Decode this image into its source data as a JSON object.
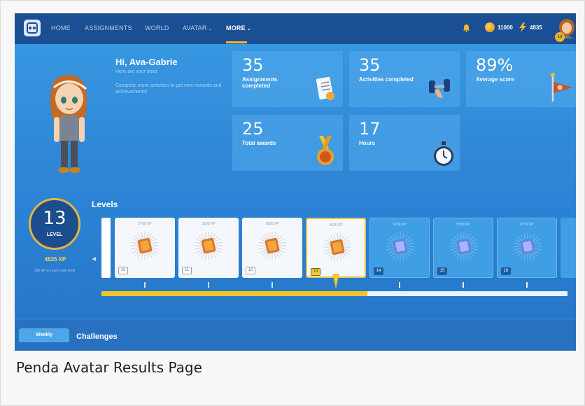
{
  "nav": {
    "items": [
      {
        "label": "HOME",
        "active": false
      },
      {
        "label": "ASSIGNMENTS",
        "active": false
      },
      {
        "label": "WORLD",
        "active": false
      },
      {
        "label": "AVATAR",
        "active": false,
        "caret": "⌄"
      },
      {
        "label": "MORE",
        "active": true,
        "caret": "⌄"
      }
    ],
    "coins": "11000",
    "xp": "4835",
    "avatar_level": "13"
  },
  "hero": {
    "greeting": "Hi, Ava-Gabrie",
    "subtitle": "Here are your stats",
    "description": "Complete more activities to get new rewards and achievements!"
  },
  "stats": [
    {
      "value": "35",
      "label": "Assignments completed",
      "icon": "document-icon"
    },
    {
      "value": "35",
      "label": "Activities completed",
      "icon": "dumbbell-icon"
    },
    {
      "value": "89%",
      "label": "Average score",
      "icon": "flag-icon"
    },
    {
      "value": "25",
      "label": "Total awards",
      "icon": "medal-icon"
    },
    {
      "value": "17",
      "label": "Hours",
      "icon": "stopwatch-icon"
    }
  ],
  "level": {
    "number": "13",
    "word": "LEVEL",
    "xp": "4835 XP",
    "hint": "365 XP to reach next level",
    "title": "Levels",
    "progress": 0.57
  },
  "levels": [
    {
      "xp": "2700 XP",
      "num": "10",
      "state": "done"
    },
    {
      "xp": "3200 XP",
      "num": "11",
      "state": "done"
    },
    {
      "xp": "3850 XP",
      "num": "12",
      "state": "done"
    },
    {
      "xp": "4530 XP",
      "num": "13",
      "state": "current"
    },
    {
      "xp": "5200 XP",
      "num": "14",
      "state": "locked"
    },
    {
      "xp": "5950 XP",
      "num": "15",
      "state": "locked"
    },
    {
      "xp": "6750 XP",
      "num": "16",
      "state": "locked"
    }
  ],
  "challenges": {
    "tab": "Weekly",
    "title": "Challenges"
  },
  "caption": "Penda Avatar Results Page",
  "colors": {
    "nav_bg": "#1b4f94",
    "accent": "#f2c425",
    "panel": "#2f86d6"
  }
}
